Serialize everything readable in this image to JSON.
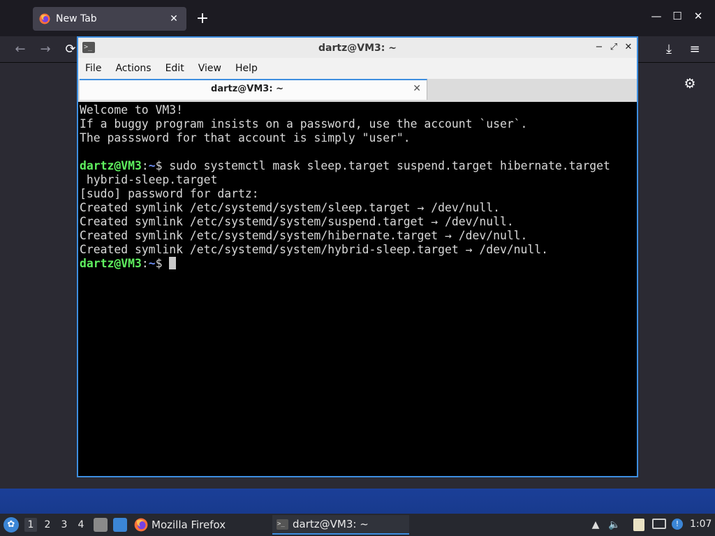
{
  "firefox": {
    "tab_title": "New Tab",
    "tab_close": "✕",
    "new_tab": "+",
    "window_controls": {
      "minimize": "—",
      "maximize": "☐",
      "close": "✕"
    },
    "nav": {
      "back": "←",
      "forward": "→",
      "reload": "⟳",
      "downloads": "⤓",
      "menu": "≡"
    },
    "settings_icon": "⚙"
  },
  "terminal": {
    "window_title": "dartz@VM3: ~",
    "app_icon": ">_",
    "title_buttons": {
      "minimize": "−",
      "maximize": "⤢",
      "close": "✕"
    },
    "menu": [
      "File",
      "Actions",
      "Edit",
      "View",
      "Help"
    ],
    "tab_title": "dartz@VM3: ~",
    "tab_close": "✕",
    "prompt_user": "dartz@VM3",
    "prompt_sep": ":",
    "prompt_path": "~",
    "prompt_symbol": "$ ",
    "lines": [
      "Welcome to VM3!",
      "If a buggy program insists on a password, use the account `user`.",
      "The passsword for that account is simply \"user\".",
      ""
    ],
    "command": "sudo systemctl mask sleep.target suspend.target hibernate.target",
    "command_wrap": " hybrid-sleep.target",
    "output": [
      "[sudo] password for dartz:",
      "Created symlink /etc/systemd/system/sleep.target → /dev/null.",
      "Created symlink /etc/systemd/system/suspend.target → /dev/null.",
      "Created symlink /etc/systemd/system/hibernate.target → /dev/null.",
      "Created symlink /etc/systemd/system/hybrid-sleep.target → /dev/null."
    ]
  },
  "taskbar": {
    "workspaces": [
      "1",
      "2",
      "3",
      "4"
    ],
    "tasks": {
      "firefox": "Mozilla Firefox",
      "terminal": "dartz@VM3: ~"
    },
    "clock": "1:07"
  },
  "colors": {
    "accent": "#3d8ee0",
    "prompt_user": "#5ff05f",
    "prompt_path": "#6e8ef2"
  }
}
